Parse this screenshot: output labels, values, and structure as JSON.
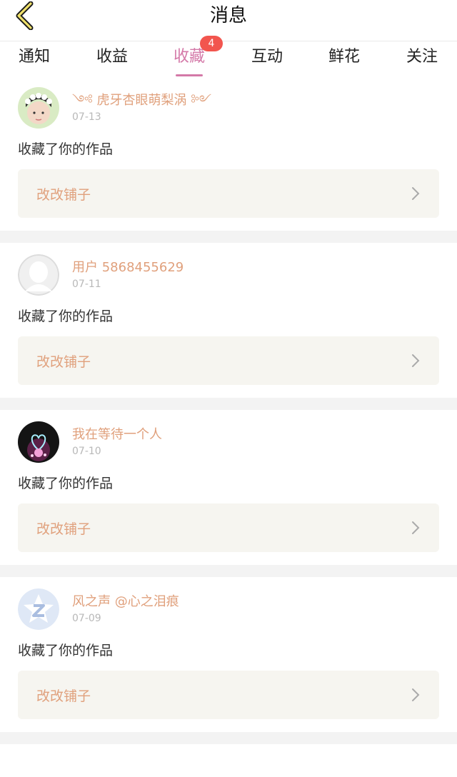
{
  "header": {
    "title": "消息",
    "back_icon": "chevron-left-icon"
  },
  "tabs": [
    {
      "label": "通知",
      "active": false
    },
    {
      "label": "收益",
      "active": false
    },
    {
      "label": "收藏",
      "active": true,
      "badge": "4"
    },
    {
      "label": "互动",
      "active": false
    },
    {
      "label": "鲜花",
      "active": false
    },
    {
      "label": "关注",
      "active": false
    }
  ],
  "colors": {
    "accent": "#d479a8",
    "badge": "#f2554e",
    "username": "#e0a07c",
    "work_bg": "#f6f5f0"
  },
  "messages": [
    {
      "username": "虎牙杏眼萌梨涡",
      "date": "07-13",
      "action": "收藏了你的作品",
      "work_title": "改改铺子",
      "avatar": "flower-crown-avatar"
    },
    {
      "username": "用户 5868455629",
      "date": "07-11",
      "action": "收藏了你的作品",
      "work_title": "改改铺子",
      "avatar": "default-user-avatar"
    },
    {
      "username": "我在等待一个人",
      "date": "07-10",
      "action": "收藏了你的作品",
      "work_title": "改改铺子",
      "avatar": "heart-glow-avatar"
    },
    {
      "username": "风之声 @心之泪痕",
      "date": "07-09",
      "action": "收藏了你的作品",
      "work_title": "改改铺子",
      "avatar": "qq-logo-avatar"
    }
  ]
}
